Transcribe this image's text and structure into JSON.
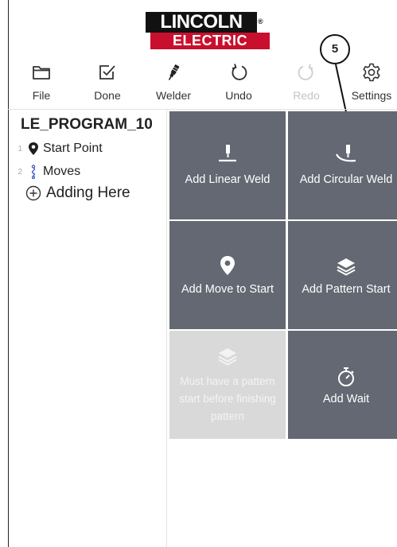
{
  "brand": {
    "line1": "LINCOLN",
    "line2": "ELECTRIC",
    "registered": "®",
    "red": "#c8102e"
  },
  "callout": {
    "number": "5"
  },
  "toolbar": {
    "items": [
      {
        "label": "File",
        "icon": "folder-icon",
        "enabled": true
      },
      {
        "label": "Done",
        "icon": "checkbox-icon",
        "enabled": true
      },
      {
        "label": "Welder",
        "icon": "welder-torch-icon",
        "enabled": true
      },
      {
        "label": "Undo",
        "icon": "undo-icon",
        "enabled": true
      },
      {
        "label": "Redo",
        "icon": "redo-icon",
        "enabled": false
      },
      {
        "label": "Settings",
        "icon": "gear-icon",
        "enabled": true
      }
    ]
  },
  "program": {
    "name": "LE_PROGRAM_10",
    "steps": [
      {
        "number": "1",
        "label": "Start Point",
        "icon": "location-pin-icon"
      },
      {
        "number": "2",
        "label": "Moves",
        "icon": "path-icon",
        "icon_color": "#3a57c4"
      }
    ],
    "add_label": "Adding Here"
  },
  "tiles": [
    {
      "label": "Add Linear Weld",
      "icon": "linear-weld-icon",
      "enabled": true
    },
    {
      "label": "Add Circular Weld",
      "icon": "circular-weld-icon",
      "enabled": true
    },
    {
      "label": "Add Move to Start",
      "icon": "location-pin-icon",
      "enabled": true
    },
    {
      "label": "Add Pattern Start",
      "icon": "layers-icon",
      "enabled": true
    },
    {
      "label": "Must have a pattern start before finishing pattern",
      "icon": "layers-icon",
      "enabled": false
    },
    {
      "label": "Add Wait",
      "icon": "stopwatch-icon",
      "enabled": true
    }
  ],
  "colors": {
    "tile": "#636872",
    "tile_disabled": "#d9d9d9"
  }
}
